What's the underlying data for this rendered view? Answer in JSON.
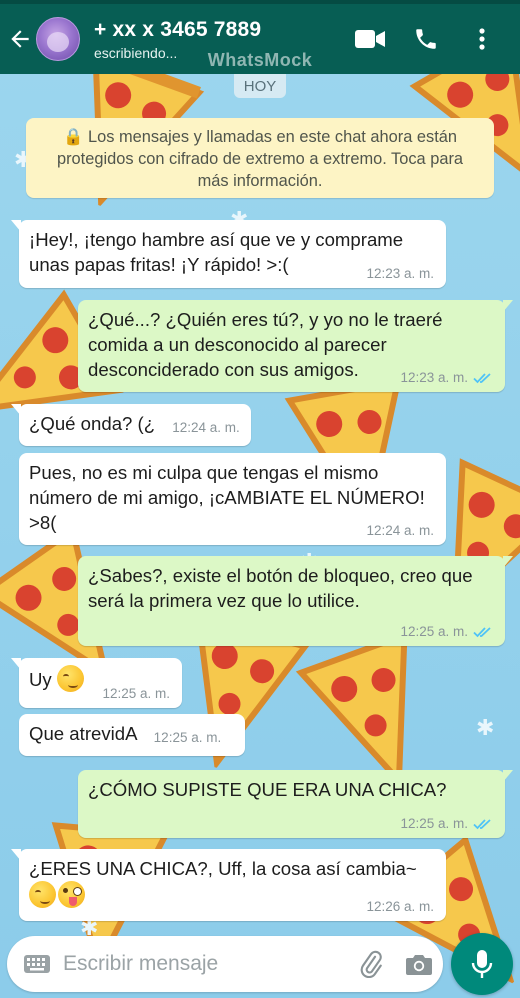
{
  "header": {
    "contact_name": "+ xx x 3465 7889",
    "status": "escribiendo...",
    "watermark": "WhatsMock"
  },
  "icons": {
    "back": "arrow-back-icon",
    "avatar": "avatar",
    "video": "video-call-icon",
    "call": "phone-icon",
    "menu": "more-vert-icon",
    "keyboard": "keyboard-icon",
    "attach": "paperclip-icon",
    "camera": "camera-icon",
    "mic": "mic-icon"
  },
  "colors": {
    "header": "#075e54",
    "incoming_bubble": "#ffffff",
    "outgoing_bubble": "#dcf8c6",
    "read_ticks": "#4fc3f7",
    "mic_button": "#00897b",
    "notice": "#fdf4c5"
  },
  "chat": {
    "date_chip": "HOY",
    "encryption_notice": "🔒 Los mensajes y llamadas en este chat ahora están protegidos con cifrado de extremo a extremo. Toca para más información.",
    "messages": [
      {
        "dir": "in",
        "text": "¡Hey!, ¡tengo hambre así que ve y comprame unas papas fritas! ¡Y rápido! >:(",
        "time": "12:23 a. m."
      },
      {
        "dir": "out",
        "text": "¿Qué...? ¿Quién eres tú?, y yo no le traeré comida a un desconocido al parecer desconciderado con sus amigos.",
        "time": "12:23 a. m.",
        "read": true
      },
      {
        "dir": "in",
        "text": "¿Qué onda? (¿",
        "time": "12:24 a. m."
      },
      {
        "dir": "in",
        "text": "Pues, no es mi culpa que tengas el mismo número de mi amigo, ¡cAMBIATE EL NÚMERO! >8(",
        "time": "12:24 a. m."
      },
      {
        "dir": "out",
        "text": "¿Sabes?, existe el botón de bloqueo, creo que será la primera vez que lo utilice.",
        "time": "12:25 a. m.",
        "read": true
      },
      {
        "dir": "in",
        "text": "Uy",
        "emoji": "smirking-face",
        "time": "12:25 a. m."
      },
      {
        "dir": "in",
        "text": "Que atrevidA",
        "time": "12:25 a. m."
      },
      {
        "dir": "out",
        "text": "¿CÓMO SUPISTE QUE ERA UNA CHICA?",
        "time": "12:25 a. m.",
        "read": true
      },
      {
        "dir": "in",
        "text": "¿ERES UNA CHICA?, Uff, la cosa así cambia~",
        "emojis": [
          "smirking-face",
          "winking-tongue-face"
        ],
        "time": "12:26 a. m."
      }
    ]
  },
  "composer": {
    "placeholder": "Escribir mensaje",
    "value": ""
  }
}
